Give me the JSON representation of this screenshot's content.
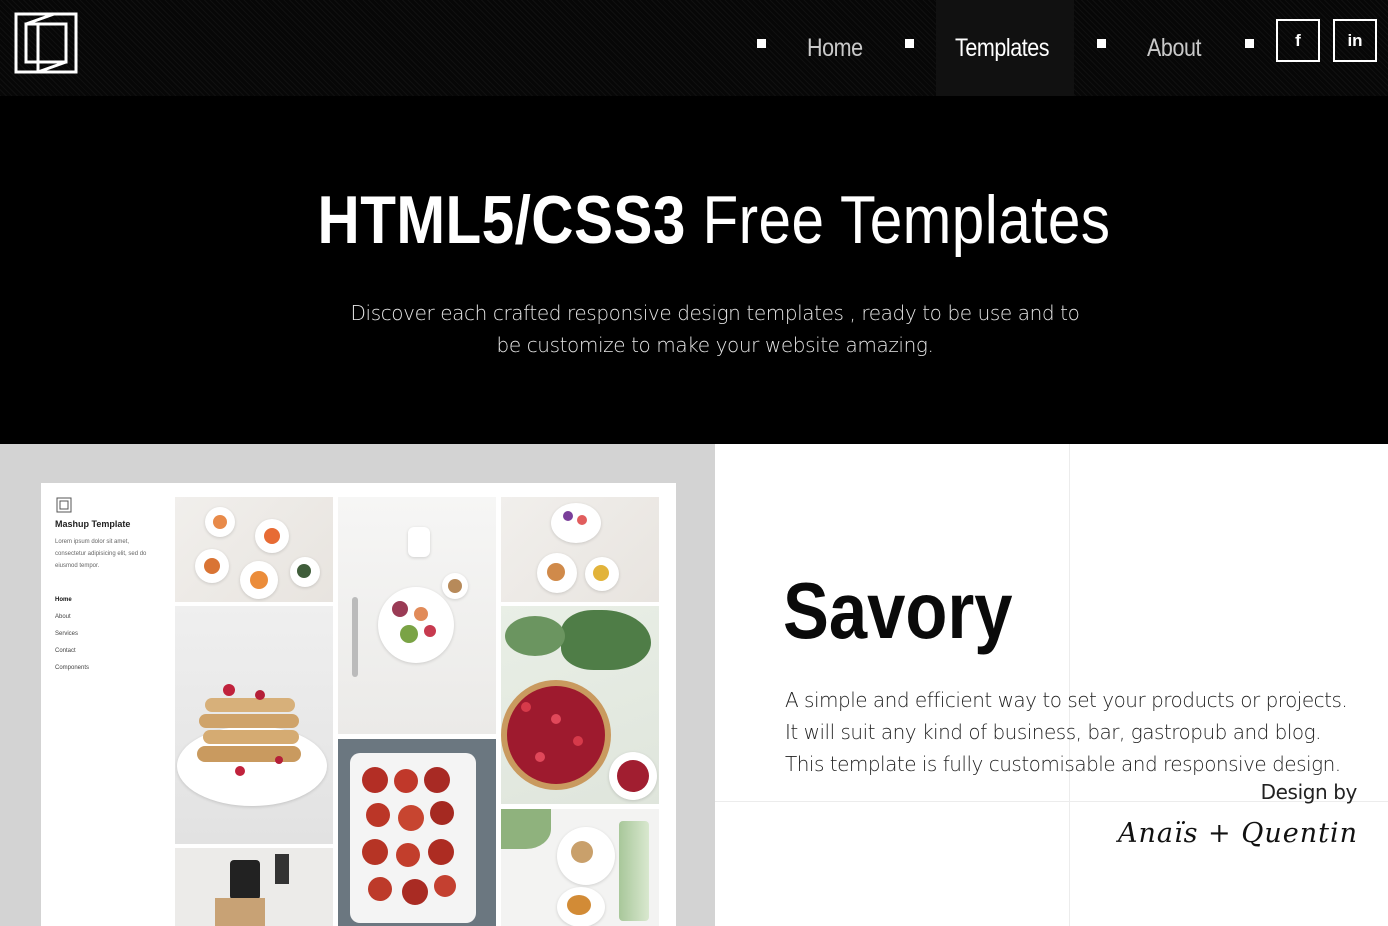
{
  "header": {
    "nav": [
      {
        "label": "Home",
        "active": false
      },
      {
        "label": "Templates",
        "active": true
      },
      {
        "label": "About",
        "active": false
      }
    ],
    "social": [
      {
        "label": "f",
        "icon": "facebook-icon"
      },
      {
        "label": "in",
        "icon": "linkedin-icon"
      }
    ]
  },
  "hero": {
    "title_bold": "HTML5/CSS3",
    "title_rest": " Free Templates",
    "subtitle_line1": "Discover each crafted responsive design templates , ready to be use and to",
    "subtitle_line2": "be customize to make your website amazing."
  },
  "preview": {
    "mock_title": "Mashup Template",
    "mock_desc": "Lorem ipsum dolor sit amet, consectetur adipisicing elit, sed do eiusmod tempor.",
    "mock_nav": [
      "Home",
      "About",
      "Services",
      "Contact",
      "Components"
    ]
  },
  "template": {
    "name": "Savory",
    "desc_line1": "A simple and efficient way to set your products or projects.",
    "desc_line2": "It will suit any kind of business, bar, gastropub and blog.",
    "desc_line3": "This template is fully customisable and responsive design.",
    "design_by": "Design by",
    "signature": "Anaïs + Quentin"
  },
  "colors": {
    "background": "#000000",
    "header": "#070707",
    "preview_bg": "#d3d3d3",
    "text_dark": "#0a0a0a"
  }
}
